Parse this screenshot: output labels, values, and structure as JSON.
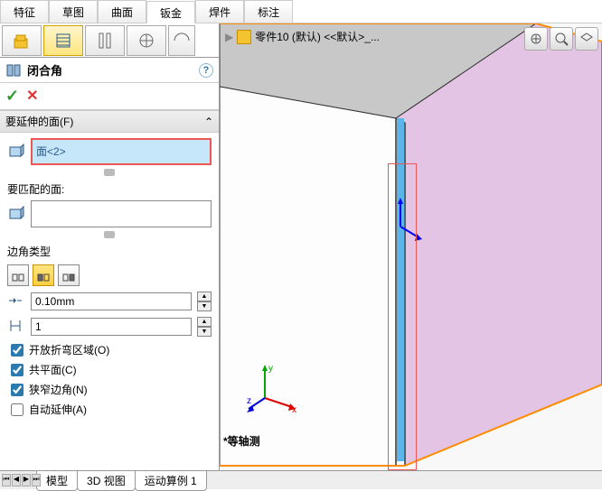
{
  "ribbon": {
    "tabs": [
      "特征",
      "草图",
      "曲面",
      "钣金",
      "焊件",
      "标注"
    ],
    "active_index": 3
  },
  "panel_tabs": [
    "feature-tree",
    "property",
    "config",
    "appearance",
    "dim"
  ],
  "feature": {
    "title": "闭合角",
    "ok": "✓",
    "cancel": "✕"
  },
  "faces_extend": {
    "header": "要延伸的面(F)",
    "items": [
      "面<2>"
    ]
  },
  "faces_match": {
    "label": "要匹配的面:"
  },
  "corner": {
    "label": "边角类型"
  },
  "gap": {
    "value": "0.10mm"
  },
  "ratio": {
    "value": "1"
  },
  "checks": {
    "open_bend": "开放折弯区域(O)",
    "coplanar": "共平面(C)",
    "narrow_corner": "狭窄边角(N)",
    "auto_extend": "自动延伸(A)"
  },
  "breadcrumb": {
    "part": "零件10 (默认) <<默认>_..."
  },
  "scene": {
    "label": "*等轴测"
  },
  "bottom_tabs": [
    "模型",
    "3D 视图",
    "运动算例 1"
  ],
  "triad": {
    "x": "x",
    "y": "y",
    "z": "z"
  }
}
